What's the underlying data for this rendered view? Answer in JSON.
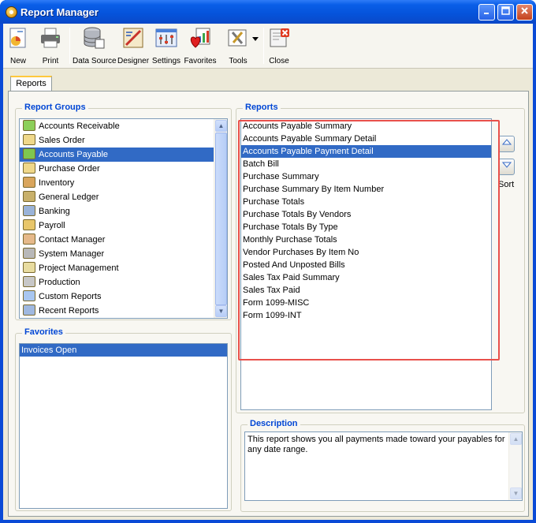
{
  "window": {
    "title": "Report Manager"
  },
  "toolbar": {
    "new": "New",
    "print": "Print",
    "data_source": "Data Source",
    "designer": "Designer",
    "settings": "Settings",
    "favorites": "Favorites",
    "tools": "Tools",
    "close": "Close"
  },
  "tab": {
    "label": "Reports"
  },
  "report_groups": {
    "title": "Report Groups",
    "items": [
      {
        "label": "Accounts Receivable",
        "icon": "money-icon"
      },
      {
        "label": "Sales Order",
        "icon": "document-icon"
      },
      {
        "label": "Accounts Payable",
        "icon": "money-bag-icon"
      },
      {
        "label": "Purchase Order",
        "icon": "document-icon"
      },
      {
        "label": "Inventory",
        "icon": "boxes-icon"
      },
      {
        "label": "General Ledger",
        "icon": "book-icon"
      },
      {
        "label": "Banking",
        "icon": "bank-icon"
      },
      {
        "label": "Payroll",
        "icon": "payroll-icon"
      },
      {
        "label": "Contact Manager",
        "icon": "contacts-icon"
      },
      {
        "label": "System Manager",
        "icon": "gear-icon"
      },
      {
        "label": "Project Management",
        "icon": "project-icon"
      },
      {
        "label": "Production",
        "icon": "gears-icon"
      },
      {
        "label": "Custom Reports",
        "icon": "folder-icon"
      },
      {
        "label": "Recent Reports",
        "icon": "clock-icon"
      }
    ],
    "selected_index": 2
  },
  "favorites": {
    "title": "Favorites",
    "items": [
      "Invoices Open"
    ]
  },
  "reports": {
    "title": "Reports",
    "items": [
      "Accounts Payable Summary",
      "Accounts Payable Summary Detail",
      "Accounts Payable Payment Detail",
      "Batch Bill",
      "Purchase Summary",
      "Purchase Summary By Item Number",
      "Purchase Totals",
      "Purchase Totals By Vendors",
      "Purchase Totals By Type",
      "Monthly Purchase Totals",
      "Vendor Purchases By Item No",
      "Posted And Unposted Bills",
      "Sales Tax Paid Summary",
      "Sales Tax Paid",
      "Form 1099-MISC",
      "Form 1099-INT"
    ],
    "selected_index": 2,
    "sort_label": "Sort"
  },
  "description": {
    "title": "Description",
    "text": "This report shows you all payments made toward your payables for any date range."
  },
  "colors": {
    "selection": "#316ac5",
    "group_title": "#0046d5",
    "highlight": "#e8504b",
    "titlebar": "#0553da"
  }
}
